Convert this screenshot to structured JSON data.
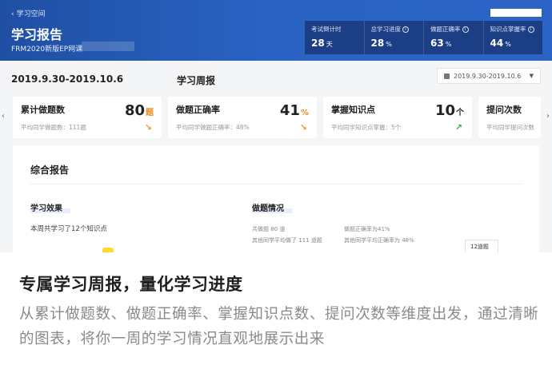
{
  "header": {
    "back_label": "学习空间",
    "title": "学习报告",
    "course": "FRM2020新版EP网课",
    "stats": [
      {
        "label": "考试倒计时",
        "value": "28",
        "unit": "天",
        "info": false
      },
      {
        "label": "总学习进度",
        "value": "28",
        "unit": "%",
        "info": true
      },
      {
        "label": "做题正确率",
        "value": "63",
        "unit": "%",
        "info": true
      },
      {
        "label": "知识点掌握率",
        "value": "44",
        "unit": "%",
        "info": true
      }
    ]
  },
  "period": {
    "date_range": "2019.9.30-2019.10.6",
    "weekly_title": "学习周报",
    "select_value": "2019.9.30-2019.10.6"
  },
  "cards": [
    {
      "title": "累计做题数",
      "value": "80",
      "unit": "题",
      "sub": "平均同学做题数：111题",
      "trend": "down"
    },
    {
      "title": "做题正确率",
      "value": "41",
      "unit": "%",
      "sub": "平均同学做题正确率：48%",
      "trend": "down"
    },
    {
      "title": "掌握知识点",
      "value": "10",
      "unit": "个",
      "sub": "平均同学知识点掌握：5个",
      "trend": "up"
    },
    {
      "title": "提问次数",
      "value": "",
      "unit": "",
      "sub": "平均同学提问次数",
      "trend": ""
    }
  ],
  "report": {
    "title": "综合报告",
    "effect_title": "学习效果",
    "effect_text": "本周共学习了12个知识点",
    "exercise_title": "做题情况",
    "exercise_lines": [
      "共做题 80 道",
      "做题正确率为41%",
      "其他同学平均做了 111 道题",
      "其他同学平均正确率为 48%"
    ],
    "chart_label": "12道题"
  },
  "caption": {
    "title": "专属学习周报，量化学习进度",
    "body": "从累计做题数、做题正确率、掌握知识点数、提问次数等维度出发，通过清晰的图表，将你一周的学习情况直观地展示出来"
  }
}
